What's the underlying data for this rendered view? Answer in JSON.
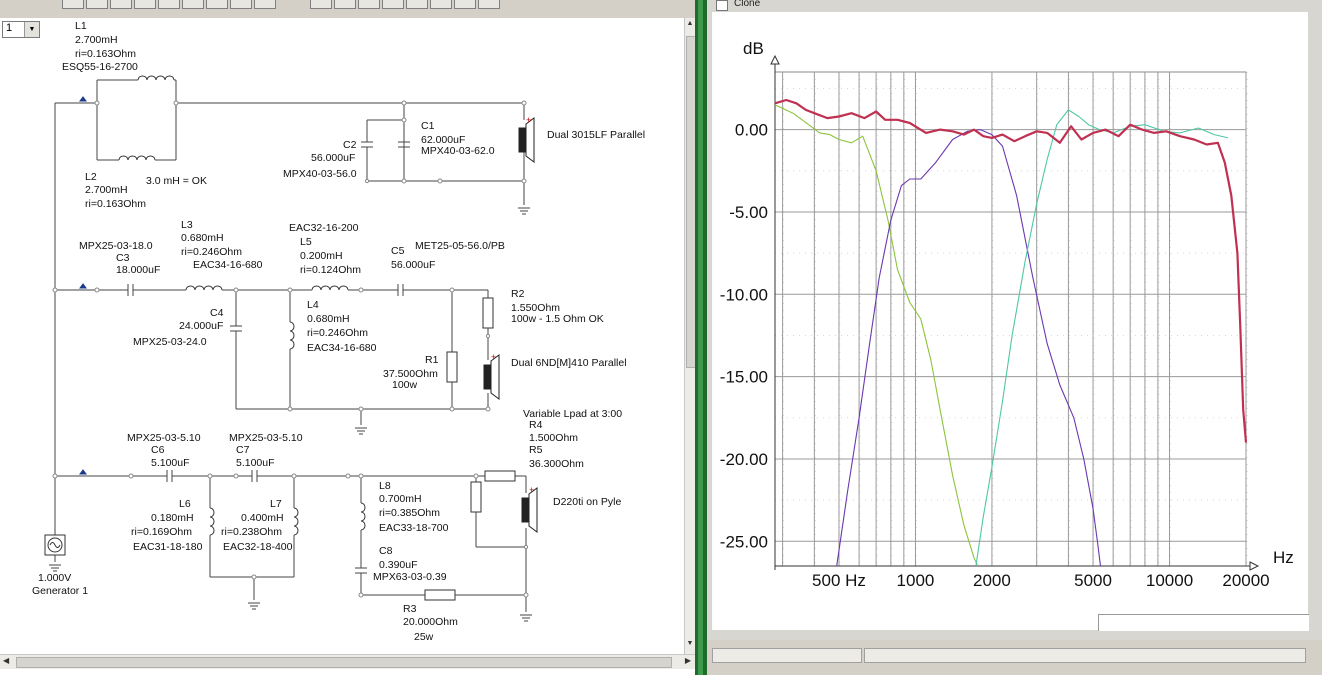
{
  "window": {
    "clone_label": "Clone"
  },
  "selector": {
    "value": "1",
    "arrow": "▼"
  },
  "labels": {
    "l1": [
      "L1",
      "2.700mH",
      "ri=0.163Ohm",
      "ESQ55-16-2700"
    ],
    "l2": [
      "L2",
      "2.700mH",
      "ri=0.163Ohm"
    ],
    "note3mh": "3.0 mH = OK",
    "c2": [
      "C2",
      "56.000uF",
      "MPX40-03-56.0"
    ],
    "c1": [
      "C1",
      "62.000uF",
      "MPX40-03-62.0"
    ],
    "woofer": "Dual 3015LF Parallel",
    "c3": [
      "MPX25-03-18.0",
      "C3",
      "18.000uF"
    ],
    "l3": [
      "L3",
      "0.680mH",
      "ri=0.246Ohm",
      "EAC34-16-680"
    ],
    "l5": [
      "EAC32-16-200",
      "L5",
      "0.200mH",
      "ri=0.124Ohm"
    ],
    "c5": [
      "C5",
      "MET25-05-56.0/PB",
      "56.000uF"
    ],
    "c4": [
      "C4",
      "24.000uF",
      "MPX25-03-24.0"
    ],
    "l4": [
      "L4",
      "0.680mH",
      "ri=0.246Ohm",
      "EAC34-16-680"
    ],
    "r2": [
      "R2",
      "1.550Ohm",
      "100w - 1.5 Ohm OK"
    ],
    "r1": [
      "R1",
      "37.500Ohm",
      "100w"
    ],
    "mid": "Dual 6ND[M]410 Parallel",
    "lpad": "Variable Lpad at 3:00",
    "r4": [
      "R4",
      "1.500Ohm"
    ],
    "r5": [
      "R5",
      "36.300Ohm"
    ],
    "c6": [
      "MPX25-03-5.10",
      "C6",
      "5.100uF"
    ],
    "c7": [
      "MPX25-03-5.10",
      "C7",
      "5.100uF"
    ],
    "l6": [
      "L6",
      "0.180mH",
      "ri=0.169Ohm",
      "EAC31-18-180"
    ],
    "l7": [
      "L7",
      "0.400mH",
      "ri=0.238Ohm",
      "EAC32-18-400"
    ],
    "l8": [
      "L8",
      "0.700mH",
      "ri=0.385Ohm",
      "EAC33-18-700"
    ],
    "c8": [
      "C8",
      "0.390uF",
      "MPX63-03-0.39"
    ],
    "r3": [
      "R3",
      "20.000Ohm",
      "25w"
    ],
    "tweeter": "D220ti on Pyle",
    "gen": [
      "1.000V",
      "Generator 1"
    ]
  },
  "chart_data": {
    "type": "line",
    "ylabel": "dB",
    "xlabel": "Hz",
    "x_scale": "log",
    "xlim": [
      280,
      20000
    ],
    "ylim": [
      -26.5,
      3.5
    ],
    "y_ticks": [
      "0.00",
      "-5.00",
      "-10.00",
      "-15.00",
      "-20.00",
      "-25.00"
    ],
    "y_tick_values": [
      0,
      -5,
      -10,
      -15,
      -20,
      -25
    ],
    "x_ticks": [
      "500 Hz",
      "1000",
      "2000",
      "5000",
      "10000",
      "20000"
    ],
    "x_tick_values": [
      500,
      1000,
      2000,
      5000,
      10000,
      20000
    ],
    "grid": true,
    "series": [
      {
        "color": "#8cc43c",
        "x": [
          280,
          330,
          380,
          420,
          460,
          500,
          560,
          620,
          700,
          780,
          850,
          950,
          1050,
          1150,
          1250,
          1400,
          1550,
          1700,
          1760
        ],
        "y": [
          1.5,
          1.0,
          0.3,
          -0.2,
          -0.3,
          -0.6,
          -0.8,
          -0.4,
          -2.5,
          -5.5,
          -8.5,
          -10.5,
          -11.5,
          -14.0,
          -17.0,
          -21.0,
          -24.0,
          -26.0,
          -26.5
        ]
      },
      {
        "color": "#6a38b0",
        "x": [
          490,
          540,
          600,
          660,
          720,
          800,
          880,
          950,
          1050,
          1200,
          1400,
          1600,
          1800,
          2000,
          2200,
          2500,
          2900,
          3300,
          3700,
          4200,
          4600,
          5000,
          5200,
          5350
        ],
        "y": [
          -26.5,
          -22.0,
          -17.5,
          -13.0,
          -9.0,
          -5.5,
          -3.4,
          -3.0,
          -3.0,
          -2.0,
          -0.6,
          -0.1,
          0.0,
          -0.3,
          -1.0,
          -4.0,
          -9.0,
          -13.0,
          -15.5,
          -17.5,
          -20.0,
          -23.0,
          -25.0,
          -26.5
        ]
      },
      {
        "color": "#4ec8a4",
        "x": [
          1730,
          1850,
          2000,
          2200,
          2400,
          2700,
          3000,
          3300,
          3600,
          4000,
          4400,
          4800,
          5300,
          6000,
          7000,
          8000,
          9500,
          11000,
          13000,
          15000,
          17000
        ],
        "y": [
          -26.5,
          -23.5,
          -20.5,
          -16.5,
          -12.5,
          -8.0,
          -4.5,
          -1.8,
          0.3,
          1.2,
          0.8,
          0.3,
          0.0,
          -0.2,
          0.2,
          0.3,
          -0.1,
          -0.2,
          0.1,
          -0.3,
          -0.5
        ]
      },
      {
        "color": "#c03050",
        "x": [
          280,
          310,
          340,
          370,
          400,
          450,
          500,
          560,
          630,
          700,
          760,
          850,
          950,
          1100,
          1250,
          1400,
          1550,
          1700,
          1850,
          2000,
          2200,
          2450,
          2700,
          3000,
          3300,
          3700,
          4100,
          4500,
          5000,
          5600,
          6300,
          7000,
          7800,
          8700,
          9700,
          11000,
          12500,
          14000,
          15500,
          16500,
          17500,
          18500,
          19000,
          19500,
          20000
        ],
        "y": [
          1.6,
          1.8,
          1.6,
          1.2,
          1.0,
          0.7,
          0.8,
          1.0,
          0.7,
          1.1,
          0.6,
          0.6,
          0.4,
          -0.2,
          0.0,
          -0.1,
          -0.3,
          0.0,
          -0.4,
          -0.5,
          -0.3,
          -0.7,
          -0.4,
          -0.1,
          -0.2,
          -0.8,
          0.2,
          -0.6,
          -0.2,
          0.0,
          -0.4,
          0.3,
          0.0,
          -0.2,
          -0.1,
          -0.4,
          -0.6,
          -0.9,
          -0.8,
          -2.0,
          -4.0,
          -7.5,
          -12.0,
          -17.0,
          -19.0
        ]
      }
    ]
  }
}
